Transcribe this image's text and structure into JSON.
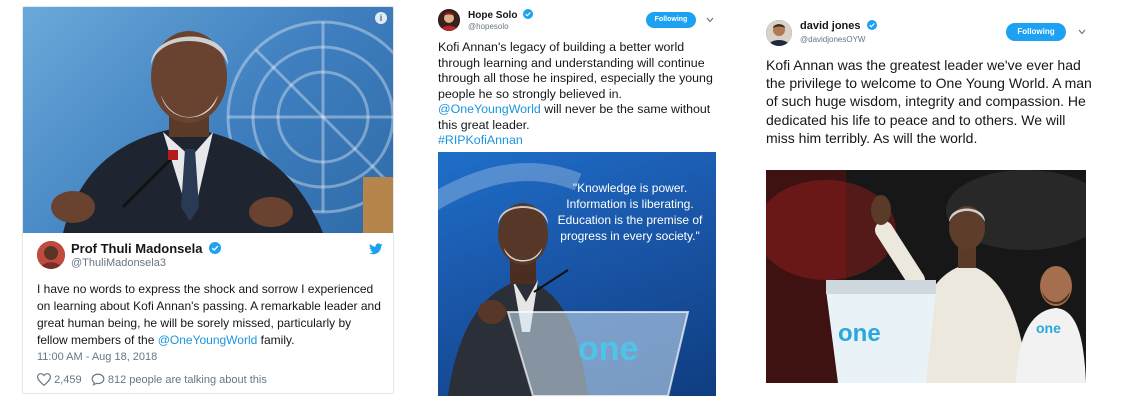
{
  "card1": {
    "author_name": "Prof Thuli Madonsela",
    "author_handle": "@ThuliMadonsela3",
    "tweet_text_before": "I have no words to express the shock and sorrow I experienced on learning about Kofi Annan's passing. A remarkable leader and great human being, he will be sorely missed, particularly by fellow members of the ",
    "tweet_mention": "@OneYoungWorld",
    "tweet_text_after": " family.",
    "timestamp": "11:00 AM - Aug 18, 2018",
    "likes": "2,459",
    "talking": "812 people are talking about this",
    "icons": [
      "info-icon",
      "verified-icon",
      "twitter-bird-icon",
      "heart-icon",
      "comment-icon"
    ]
  },
  "card2": {
    "author_name": "Hope Solo",
    "author_handle": "@hopesolo",
    "follow_label": "Following",
    "tweet_text_before": "Kofi Annan's legacy of building a better world through learning and understanding will continue through all those he inspired, especially the young people he so strongly believed in.    ",
    "tweet_mention": "@OneYoungWorld",
    "tweet_text_after": " will never be the same without this great leader.",
    "hashtag": "#RIPKofiAnnan",
    "image_quote": "\"Knowledge is power. Information is liberating. Education is the premise of progress in every society.\"",
    "podium_text": "one"
  },
  "card3": {
    "author_name": "david jones",
    "author_handle": "@davidjonesOYW",
    "follow_label": "Following",
    "tweet_text": "Kofi Annan was the greatest leader we've ever had the privilege to welcome to One Young World. A man of such huge wisdom, integrity and compassion. He dedicated his life to peace and to others. We will miss him terribly. As will the world.",
    "podium_text": "one",
    "shirt_text": "one"
  },
  "colors": {
    "twitter_blue": "#1da1f2",
    "link_blue": "#1b95e0",
    "text_dark": "#14171a",
    "text_muted": "#657786",
    "border": "#e1e8ed"
  }
}
